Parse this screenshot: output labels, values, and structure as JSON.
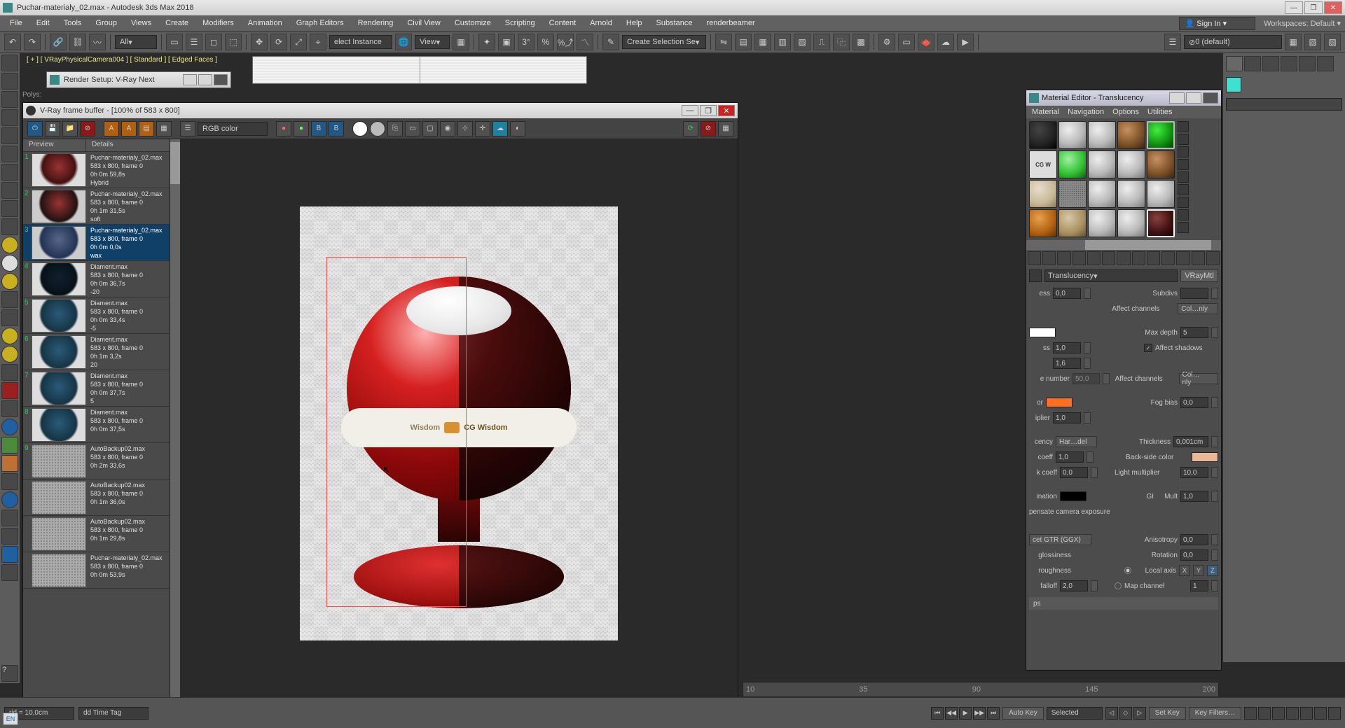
{
  "app": {
    "title": "Puchar-materialy_02.max - Autodesk 3ds Max 2018",
    "signin": "Sign In",
    "workspaces_label": "Workspaces:",
    "workspaces_value": "Default"
  },
  "menu": [
    "File",
    "Edit",
    "Tools",
    "Group",
    "Views",
    "Create",
    "Modifiers",
    "Animation",
    "Graph Editors",
    "Rendering",
    "Civil View",
    "Customize",
    "Scripting",
    "Content",
    "Arnold",
    "Help",
    "Substance",
    "renderbeamer"
  ],
  "maintool": {
    "filter": "All",
    "view": "View",
    "select_instance": "elect Instance",
    "create_sel": "Create Selection Se",
    "objlist": "0 (default)"
  },
  "viewport_label": "[ + ] [ VRayPhysicalCamera004 ] [ Standard ] [ Edged Faces ]",
  "polys_label": "Polys:",
  "render_setup": {
    "title": "Render Setup: V-Ray Next"
  },
  "vfb": {
    "title": "V-Ray frame buffer - [100% of 583 x 800]",
    "channel": "RGB color",
    "headers": {
      "preview": "Preview",
      "details": "Details"
    },
    "history": [
      {
        "n": "1",
        "file": "Puchar-materialy_02.max",
        "res": "583 x 800, frame 0",
        "time": "0h 0m 59,8s",
        "extra": "Hybrid",
        "thumb": "",
        "sel": false
      },
      {
        "n": "2",
        "file": "Puchar-materialy_02.max",
        "res": "583 x 800, frame 0",
        "time": "0h 1m 31,5s",
        "extra": "soft",
        "thumb": "b2",
        "sel": false
      },
      {
        "n": "3",
        "file": "Puchar-materialy_02.max",
        "res": "583 x 800, frame 0",
        "time": "0h 0m 0,0s",
        "extra": "wax",
        "thumb": "sel",
        "sel": true
      },
      {
        "n": "4",
        "file": "Diament.max",
        "res": "583 x 800, frame 0",
        "time": "0h 0m 36,7s",
        "extra": "-20",
        "thumb": "dmt1",
        "sel": false
      },
      {
        "n": "5",
        "file": "Diament.max",
        "res": "583 x 800, frame 0",
        "time": "0h 0m 33,4s",
        "extra": "-5",
        "thumb": "dmt",
        "sel": false
      },
      {
        "n": "6",
        "file": "Diament.max",
        "res": "583 x 800, frame 0",
        "time": "0h 1m 3,2s",
        "extra": "20",
        "thumb": "dmt",
        "sel": false
      },
      {
        "n": "7",
        "file": "Diament.max",
        "res": "583 x 800, frame 0",
        "time": "0h 0m 37,7s",
        "extra": "5",
        "thumb": "dmt",
        "sel": false
      },
      {
        "n": "8",
        "file": "Diament.max",
        "res": "583 x 800, frame 0",
        "time": "0h 0m 37,5s",
        "extra": "",
        "thumb": "dmt",
        "sel": false
      },
      {
        "n": "9",
        "file": "AutoBackup02.max",
        "res": "583 x 800, frame 0",
        "time": "0h 2m 33,6s",
        "extra": "",
        "thumb": "noise",
        "sel": false
      },
      {
        "n": "",
        "file": "AutoBackup02.max",
        "res": "583 x 800, frame 0",
        "time": "0h 1m 36,0s",
        "extra": "",
        "thumb": "noise",
        "sel": false
      },
      {
        "n": "",
        "file": "AutoBackup02.max",
        "res": "583 x 800, frame 0",
        "time": "0h 1m 29,8s",
        "extra": "",
        "thumb": "noise",
        "sel": false
      },
      {
        "n": "",
        "file": "Puchar-materialy_02.max",
        "res": "583 x 800, frame 0",
        "time": "0h 0m 53,9s",
        "extra": "",
        "thumb": "noise",
        "sel": false
      }
    ],
    "band_text_left": "Wisdom",
    "band_text_right": "CG Wisdom"
  },
  "medit": {
    "title": "Material Editor - Translucency",
    "menu": [
      "Material",
      "Navigation",
      "Options",
      "Utilities"
    ],
    "mat_name": "Translucency",
    "mat_type": "VRayMtl",
    "params": {
      "ess": "ess",
      "ess_val": "0,0",
      "subdivs": "Subdivs",
      "affect_channels": "Affect channels",
      "col_nly": "Col…nly",
      "ss": "ss",
      "ss_val1": "1,0",
      "ss_val2": "1,6",
      "max_depth": "Max depth",
      "max_depth_val": "5",
      "affect_shadows": "Affect shadows",
      "e_number": "e number",
      "e_number_val": "50,0",
      "or": "or",
      "fog_bias": "Fog bias",
      "fog_bias_val": "0,0",
      "iplier": "iplier",
      "iplier_val": "1,0",
      "cency": "cency",
      "cency_dd": "Har…del",
      "thickness": "Thickness",
      "thickness_val": "0,001cm",
      "coeff": "coeff",
      "coeff_val": "1,0",
      "back_side": "Back-side color",
      "kcoeff": "k coeff",
      "kcoeff_val": "0,0",
      "light_mult": "Light multiplier",
      "light_mult_val": "10,0",
      "ination": "ination",
      "gi": "GI",
      "mult": "Mult",
      "mult_val": "1,0",
      "pensate": "pensate camera exposure",
      "cet": "cet GTR (GGX)",
      "anisotropy": "Anisotropy",
      "anisotropy_val": "0,0",
      "glossiness": "glossiness",
      "rotation": "Rotation",
      "rotation_val": "0,0",
      "roughness": "roughness",
      "local_axis": "Local axis",
      "falloff": "falloff",
      "falloff_val": "2,0",
      "map_channel": "Map channel",
      "map_channel_val": "1",
      "ps": "ps"
    }
  },
  "timebar": {
    "ticks": [
      "10",
      "35",
      "90",
      "145",
      "200"
    ]
  },
  "status": {
    "grid": "rid = 10,0cm",
    "timetag": "dd Time Tag",
    "autokey": "Auto Key",
    "setkey": "Set Key",
    "selected": "Selected",
    "keyfilters": "Key Filters…"
  },
  "lang": "EN"
}
